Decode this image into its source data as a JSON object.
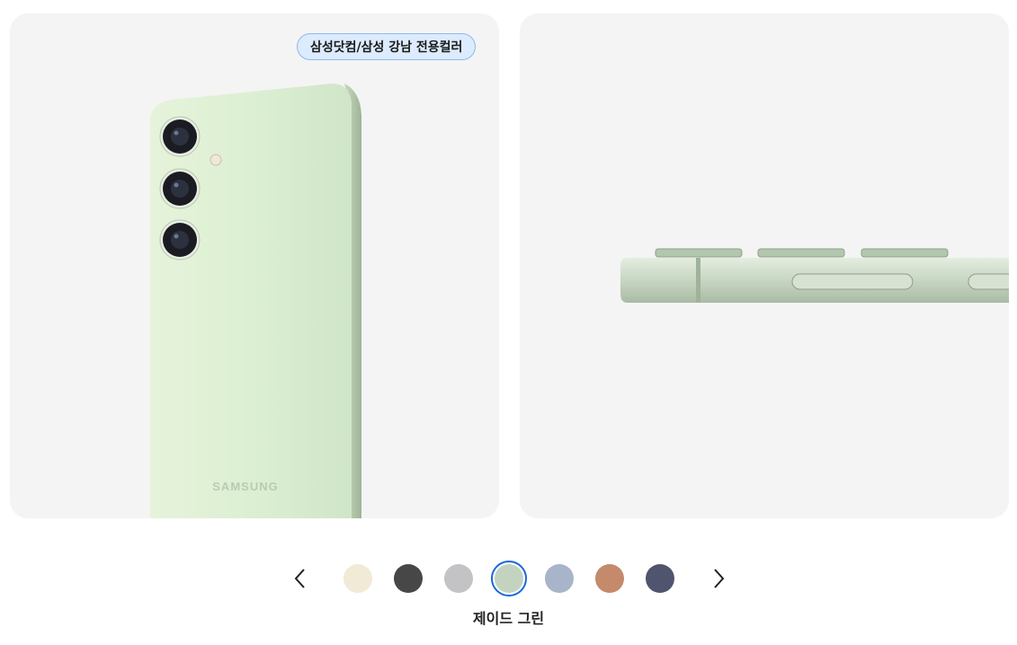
{
  "badge": {
    "label": "삼성닷컴/삼성 강남 전용컬러"
  },
  "phone": {
    "brand_text": "SAMSUNG"
  },
  "gallery": {
    "prev_icon": "chevron-left-icon",
    "next_icon": "chevron-right-icon",
    "selected_color_name": "제이드 그린",
    "swatches": [
      {
        "name": "cream",
        "color": "#f1ead6"
      },
      {
        "name": "onyx-black",
        "color": "#474747"
      },
      {
        "name": "marble-gray",
        "color": "#c3c3c5"
      },
      {
        "name": "jade-green",
        "color": "#c3d3c0",
        "selected": true
      },
      {
        "name": "sapphire-blue",
        "color": "#a7b4c9"
      },
      {
        "name": "sandstone-orange",
        "color": "#c48a6b"
      },
      {
        "name": "cobalt-violet",
        "color": "#50546e"
      }
    ]
  }
}
